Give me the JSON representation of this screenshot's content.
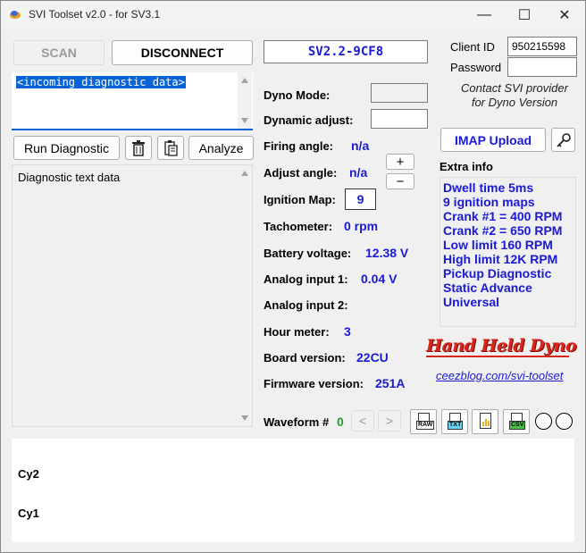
{
  "window": {
    "title": "SVI Toolset v2.0 - for SV3.1",
    "minimize": "—",
    "maximize": "☐",
    "close": "✕"
  },
  "toolbar": {
    "scan_label": "SCAN",
    "disconnect_label": "DISCONNECT"
  },
  "device_id": "SV2.2-9CF8",
  "login": {
    "client_id_label": "Client ID",
    "client_id_value": "950215598",
    "password_label": "Password",
    "password_value": "",
    "contact_note_1": "Contact SVI provider",
    "contact_note_2": "for Dyno Version"
  },
  "incoming": {
    "text": "<incoming diagnostic data>"
  },
  "actions": {
    "run_diagnostic": "Run Diagnostic",
    "analyze": "Analyze"
  },
  "diag_text": "Diagnostic text data",
  "params": {
    "dyno_mode_label": "Dyno Mode:",
    "dyno_mode_value": "",
    "dynamic_adjust_label": "Dynamic adjust:",
    "dynamic_adjust_value": "",
    "firing_angle_label": "Firing angle:",
    "firing_angle_value": "n/a",
    "adjust_angle_label": "Adjust angle:",
    "adjust_angle_value": "n/a",
    "ignition_map_label": "Ignition Map:",
    "ignition_map_value": "9",
    "tachometer_label": "Tachometer:",
    "tachometer_value": "0 rpm",
    "battery_label": "Battery voltage:",
    "battery_value": "12.38 V",
    "analog1_label": "Analog input 1:",
    "analog1_value": "0.04 V",
    "analog2_label": "Analog input 2:",
    "analog2_value": "",
    "hour_label": "Hour meter:",
    "hour_value": "3",
    "board_label": "Board version:",
    "board_value": "22CU",
    "firmware_label": "Firmware version:",
    "firmware_value": "251A",
    "plus": "+",
    "minus": "−"
  },
  "imap": {
    "upload_label": "IMAP Upload"
  },
  "extra": {
    "title": "Extra info",
    "lines": [
      "Dwell time 5ms",
      "9 ignition maps",
      "Crank #1 = 400 RPM",
      "Crank #2 = 650 RPM",
      "Low limit 160 RPM",
      "High limit 12K RPM",
      "Pickup Diagnostic",
      "Static Advance",
      "Universal"
    ]
  },
  "brand": {
    "logo_text": "Hand Held Dyno",
    "link": "ceezblog.com/svi-toolset",
    "logo_color": "#d8261c"
  },
  "waveform": {
    "label": "Waveform #",
    "value": "0",
    "prev": "<",
    "next": ">",
    "file_tags": [
      "RAW",
      "TXT",
      "CSV"
    ],
    "value_color": "#2a9a2a"
  },
  "plot": {
    "cy2": "Cy2",
    "cy1": "Cy1"
  },
  "colors": {
    "accent_blue": "#1a1ad6",
    "selection_blue": "#0a64d8"
  }
}
